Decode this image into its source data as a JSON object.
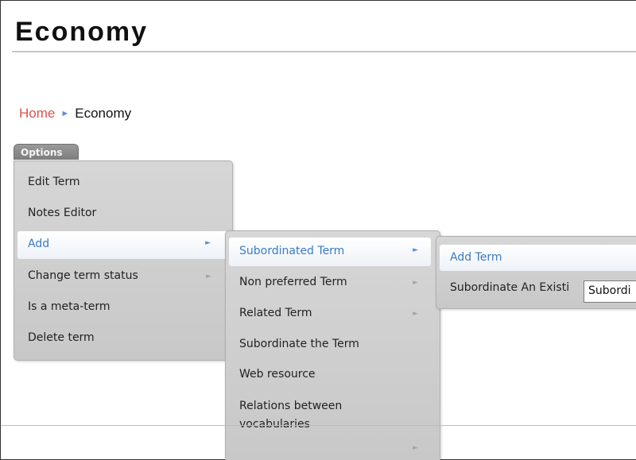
{
  "page": {
    "title": "Economy"
  },
  "breadcrumb": {
    "home": "Home",
    "separator": "►",
    "current": "Economy"
  },
  "options": {
    "label": "Options"
  },
  "menu_main": {
    "items": [
      {
        "label": "Edit Term",
        "submenu": false
      },
      {
        "label": "Notes Editor",
        "submenu": false
      },
      {
        "label": "Add",
        "submenu": true,
        "active": true
      },
      {
        "label": "Change term status",
        "submenu": true
      },
      {
        "label": "Is a meta-term",
        "submenu": false
      },
      {
        "label": "Delete term",
        "submenu": false
      }
    ]
  },
  "menu_add": {
    "items": [
      {
        "label": "Subordinated Term",
        "submenu": true,
        "active": true
      },
      {
        "label": "Non preferred Term",
        "submenu": true
      },
      {
        "label": "Related Term",
        "submenu": true
      },
      {
        "label": "Subordinate the Term",
        "submenu": false
      },
      {
        "label": "Web resource",
        "submenu": false
      },
      {
        "label": "Relations between vocabularies",
        "submenu": false
      },
      {
        "label": "",
        "submenu": true
      }
    ]
  },
  "menu_subordinated": {
    "items": [
      {
        "label": "Add Term",
        "active": true
      },
      {
        "label": "Subordinate An Existi"
      }
    ],
    "input_value": "Subordi"
  },
  "icons": {
    "submenu_arrow": "►"
  },
  "colors": {
    "link": "#d9534f",
    "active": "#3a7bc2",
    "menu_bg": "#d0d0d0"
  }
}
